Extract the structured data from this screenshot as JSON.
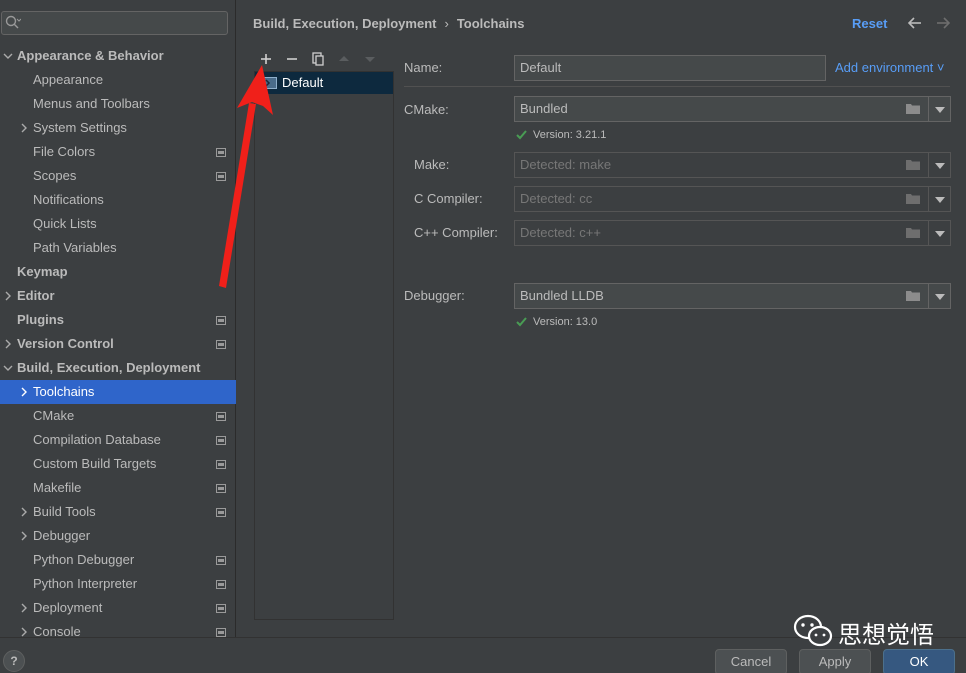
{
  "search": {
    "placeholder": "Q▾"
  },
  "sidebar": {
    "items": [
      {
        "label": "Appearance & Behavior",
        "bold": true,
        "indent": 0,
        "chevron": "down",
        "proj": false
      },
      {
        "label": "Appearance",
        "bold": false,
        "indent": 1,
        "chevron": "",
        "proj": false
      },
      {
        "label": "Menus and Toolbars",
        "bold": false,
        "indent": 1,
        "chevron": "",
        "proj": false
      },
      {
        "label": "System Settings",
        "bold": false,
        "indent": 1,
        "chevron": "right",
        "proj": false
      },
      {
        "label": "File Colors",
        "bold": false,
        "indent": 1,
        "chevron": "",
        "proj": true
      },
      {
        "label": "Scopes",
        "bold": false,
        "indent": 1,
        "chevron": "",
        "proj": true
      },
      {
        "label": "Notifications",
        "bold": false,
        "indent": 1,
        "chevron": "",
        "proj": false
      },
      {
        "label": "Quick Lists",
        "bold": false,
        "indent": 1,
        "chevron": "",
        "proj": false
      },
      {
        "label": "Path Variables",
        "bold": false,
        "indent": 1,
        "chevron": "",
        "proj": false
      },
      {
        "label": "Keymap",
        "bold": true,
        "indent": 0,
        "chevron": "",
        "proj": false
      },
      {
        "label": "Editor",
        "bold": true,
        "indent": 0,
        "chevron": "right",
        "proj": false
      },
      {
        "label": "Plugins",
        "bold": true,
        "indent": 0,
        "chevron": "",
        "proj": true
      },
      {
        "label": "Version Control",
        "bold": true,
        "indent": 0,
        "chevron": "right",
        "proj": true
      },
      {
        "label": "Build, Execution, Deployment",
        "bold": true,
        "indent": 0,
        "chevron": "down",
        "proj": false
      },
      {
        "label": "Toolchains",
        "bold": false,
        "indent": 1,
        "chevron": "right",
        "proj": false,
        "selected": true
      },
      {
        "label": "CMake",
        "bold": false,
        "indent": 1,
        "chevron": "",
        "proj": true
      },
      {
        "label": "Compilation Database",
        "bold": false,
        "indent": 1,
        "chevron": "",
        "proj": true
      },
      {
        "label": "Custom Build Targets",
        "bold": false,
        "indent": 1,
        "chevron": "",
        "proj": true
      },
      {
        "label": "Makefile",
        "bold": false,
        "indent": 1,
        "chevron": "",
        "proj": true
      },
      {
        "label": "Build Tools",
        "bold": false,
        "indent": 1,
        "chevron": "right",
        "proj": true
      },
      {
        "label": "Debugger",
        "bold": false,
        "indent": 1,
        "chevron": "right",
        "proj": false
      },
      {
        "label": "Python Debugger",
        "bold": false,
        "indent": 1,
        "chevron": "",
        "proj": true
      },
      {
        "label": "Python Interpreter",
        "bold": false,
        "indent": 1,
        "chevron": "",
        "proj": true
      },
      {
        "label": "Deployment",
        "bold": false,
        "indent": 1,
        "chevron": "right",
        "proj": true
      },
      {
        "label": "Console",
        "bold": false,
        "indent": 1,
        "chevron": "right",
        "proj": true
      }
    ]
  },
  "header": {
    "breadcrumb_parent": "Build, Execution, Deployment",
    "breadcrumb_separator": "›",
    "breadcrumb_current": "Toolchains",
    "reset_label": "Reset"
  },
  "toolchains": {
    "items": [
      {
        "label": "Default"
      }
    ]
  },
  "form": {
    "name_label": "Name:",
    "name_value": "Default",
    "add_environment_label": "Add environment ˅",
    "cmake_label": "CMake:",
    "cmake_value": "Bundled",
    "cmake_version": "Version: 3.21.1",
    "make_label": "Make:",
    "make_placeholder": "Detected: make",
    "c_compiler_label": "C Compiler:",
    "c_compiler_placeholder": "Detected: cc",
    "cpp_compiler_label": "C++ Compiler:",
    "cpp_compiler_placeholder": "Detected: c++",
    "debugger_label": "Debugger:",
    "debugger_value": "Bundled LLDB",
    "debugger_version": "Version: 13.0"
  },
  "buttons": {
    "help": "?",
    "cancel": "Cancel",
    "apply": "Apply",
    "ok": "OK"
  },
  "watermark": {
    "text": "思想觉悟"
  },
  "colors": {
    "accent_link": "#589df6",
    "selection": "#2f65ca",
    "check": "#499c54",
    "annotation_arrow": "#f0201a"
  }
}
